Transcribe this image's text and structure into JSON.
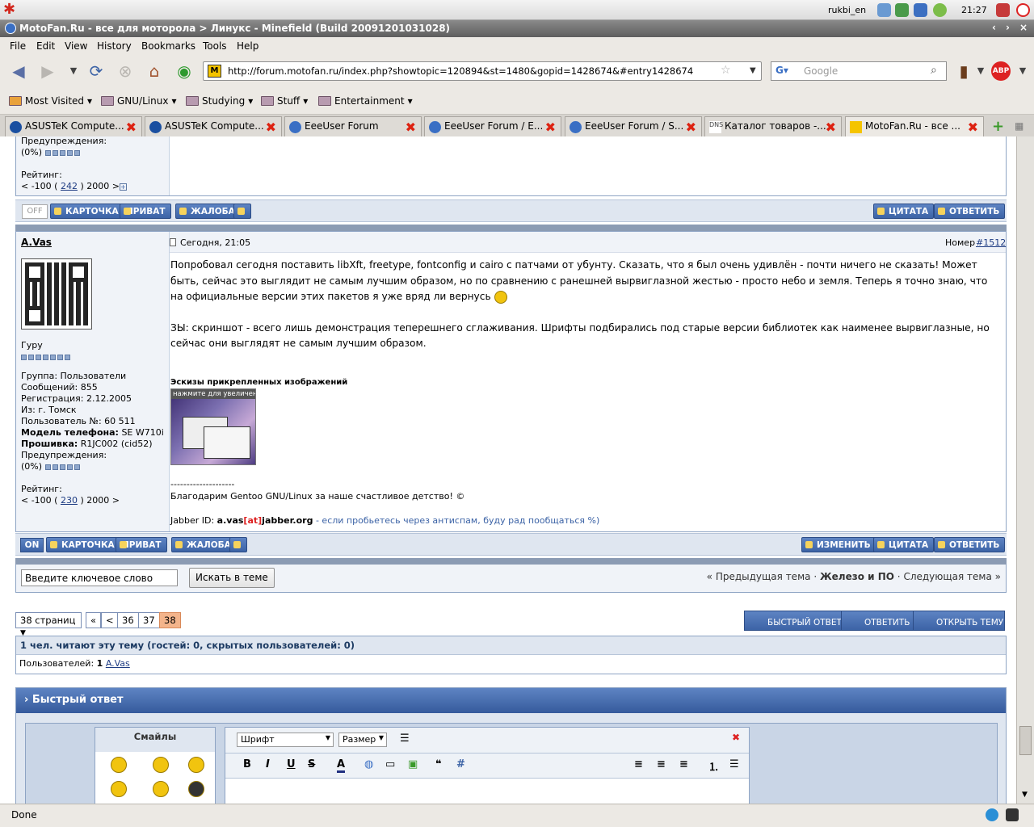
{
  "panel": {
    "user": "rukbi_en",
    "time": "21:27"
  },
  "window": {
    "title": "MotoFan.Ru - все для моторола > Линукс - Minefield (Build 20091201031028)",
    "controls": [
      "‹",
      "›",
      "×"
    ]
  },
  "menu": [
    "File",
    "Edit",
    "View",
    "History",
    "Bookmarks",
    "Tools",
    "Help"
  ],
  "url": "http://forum.motofan.ru/index.php?showtopic=120894&st=1480&gopid=1428674&#entry1428674",
  "search": {
    "placeholder": "Google"
  },
  "bookmarks": [
    "Most Visited",
    "GNU/Linux",
    "Studying",
    "Stuff",
    "Entertainment"
  ],
  "tabs": [
    "ASUSTeK Compute...",
    "ASUSTeK Compute...",
    "EeeUser Forum",
    "EeeUser Forum / E...",
    "EeeUser Forum / S...",
    "Каталог товаров -...",
    "MotoFan.Ru - все ..."
  ],
  "prev_post": {
    "warn_label": "Предупреждения:",
    "warn_value": "(0%)",
    "rating_label": "Рейтинг:",
    "rating_pre": "< -100 (",
    "rating_value": "242",
    "rating_post": ") 2000 >",
    "status": "OFF",
    "buttons": {
      "card": "КАРТОЧКА",
      "private": "ПРИВАТ",
      "complain": "ЖАЛОБА",
      "quote": "ЦИТАТА",
      "reply": "ОТВЕТИТЬ"
    }
  },
  "post": {
    "author": "A.Vas",
    "date": "Сегодня, 21:05",
    "number_label": "Номер",
    "number": "#1512",
    "rank": "Гуру",
    "info": [
      [
        "Группа:",
        "Пользователи"
      ],
      [
        "Сообщений:",
        "855"
      ],
      [
        "Регистрация:",
        "2.12.2005"
      ],
      [
        "Из:",
        "г. Томск"
      ],
      [
        "Пользователь №:",
        "60 511"
      ]
    ],
    "phone_label": "Модель телефона:",
    "phone": "SE W710i",
    "fw_label": "Прошивка:",
    "fw": "R1JC002 (cid52)",
    "warn_label": "Предупреждения:",
    "warn_value": "(0%)",
    "rating_label": "Рейтинг:",
    "rating_pre": "< -100 (",
    "rating_value": "230",
    "rating_post": ") 2000 >",
    "p1": "Попробовал сегодня поставить libXft, freetype, fontconfig и cairo с патчами от убунту. Сказать, что я был очень удивлён - почти ничего не сказать! Может быть, сейчас это выглядит не самым лучшим образом, но по сравнению с ранешней вырвиглазной жестью - просто небо и земля. Теперь я точно знаю, что на официальные версии этих пакетов я уже вряд ли вернусь",
    "p2": "ЗЫ: скриншот - всего лишь демонстрация теперешнего сглаживания. Шрифты подбирались под старые версии библиотек как наименее вырвиглазные, но сейчас они выглядят не самым лучшим образом.",
    "thumbs_title": "Эскизы прикрепленных изображений",
    "thumb_caption": "нажмите для увеличения",
    "sig_line": "--------------------",
    "sig": "Благодарим Gentoo GNU/Linux за наше счастливое детство! ©",
    "jabber_label": "Jabber ID:",
    "jabber_a": "a.vas",
    "jabber_at": "[at]",
    "jabber_b": "jabber.org",
    "jabber_note": "- если пробьетесь через антиспам, буду рад пообщаться %)",
    "status": "ON",
    "buttons": {
      "card": "КАРТОЧКА",
      "private": "ПРИВАТ",
      "complain": "ЖАЛОБА",
      "edit": "ИЗМЕНИТЬ",
      "quote": "ЦИТАТА",
      "reply": "ОТВЕТИТЬ"
    }
  },
  "topicsearch": {
    "value": "Введите ключевое слово",
    "button": "Искать в теме",
    "prev": "« Предыдущая тема",
    "sep1": "·",
    "forum": "Железо и ПО",
    "sep2": "·",
    "next": "Следующая тема »"
  },
  "pages": {
    "select": "38 страниц",
    "first": "«",
    "prev": "<",
    "p36": "36",
    "p37": "37",
    "p38": "38"
  },
  "actions": {
    "quick": "БЫСТРЫЙ ОТВЕТ",
    "reply": "ОТВЕТИТЬ",
    "new": "ОТКРЫТЬ ТЕМУ"
  },
  "readers": {
    "title": "1 чел. читают эту тему (гостей: 0, скрытых пользователей: 0)",
    "users_label": "Пользователей:",
    "users_count": "1",
    "user": "A.Vas"
  },
  "quickreply": {
    "title": "Быстрый ответ",
    "smileys": "Смайлы",
    "font": "Шрифт",
    "size": "Размер"
  },
  "statusbar": "Done",
  "colors": {
    "accent": "#3c63a6",
    "page_current": "#f3b48b"
  }
}
